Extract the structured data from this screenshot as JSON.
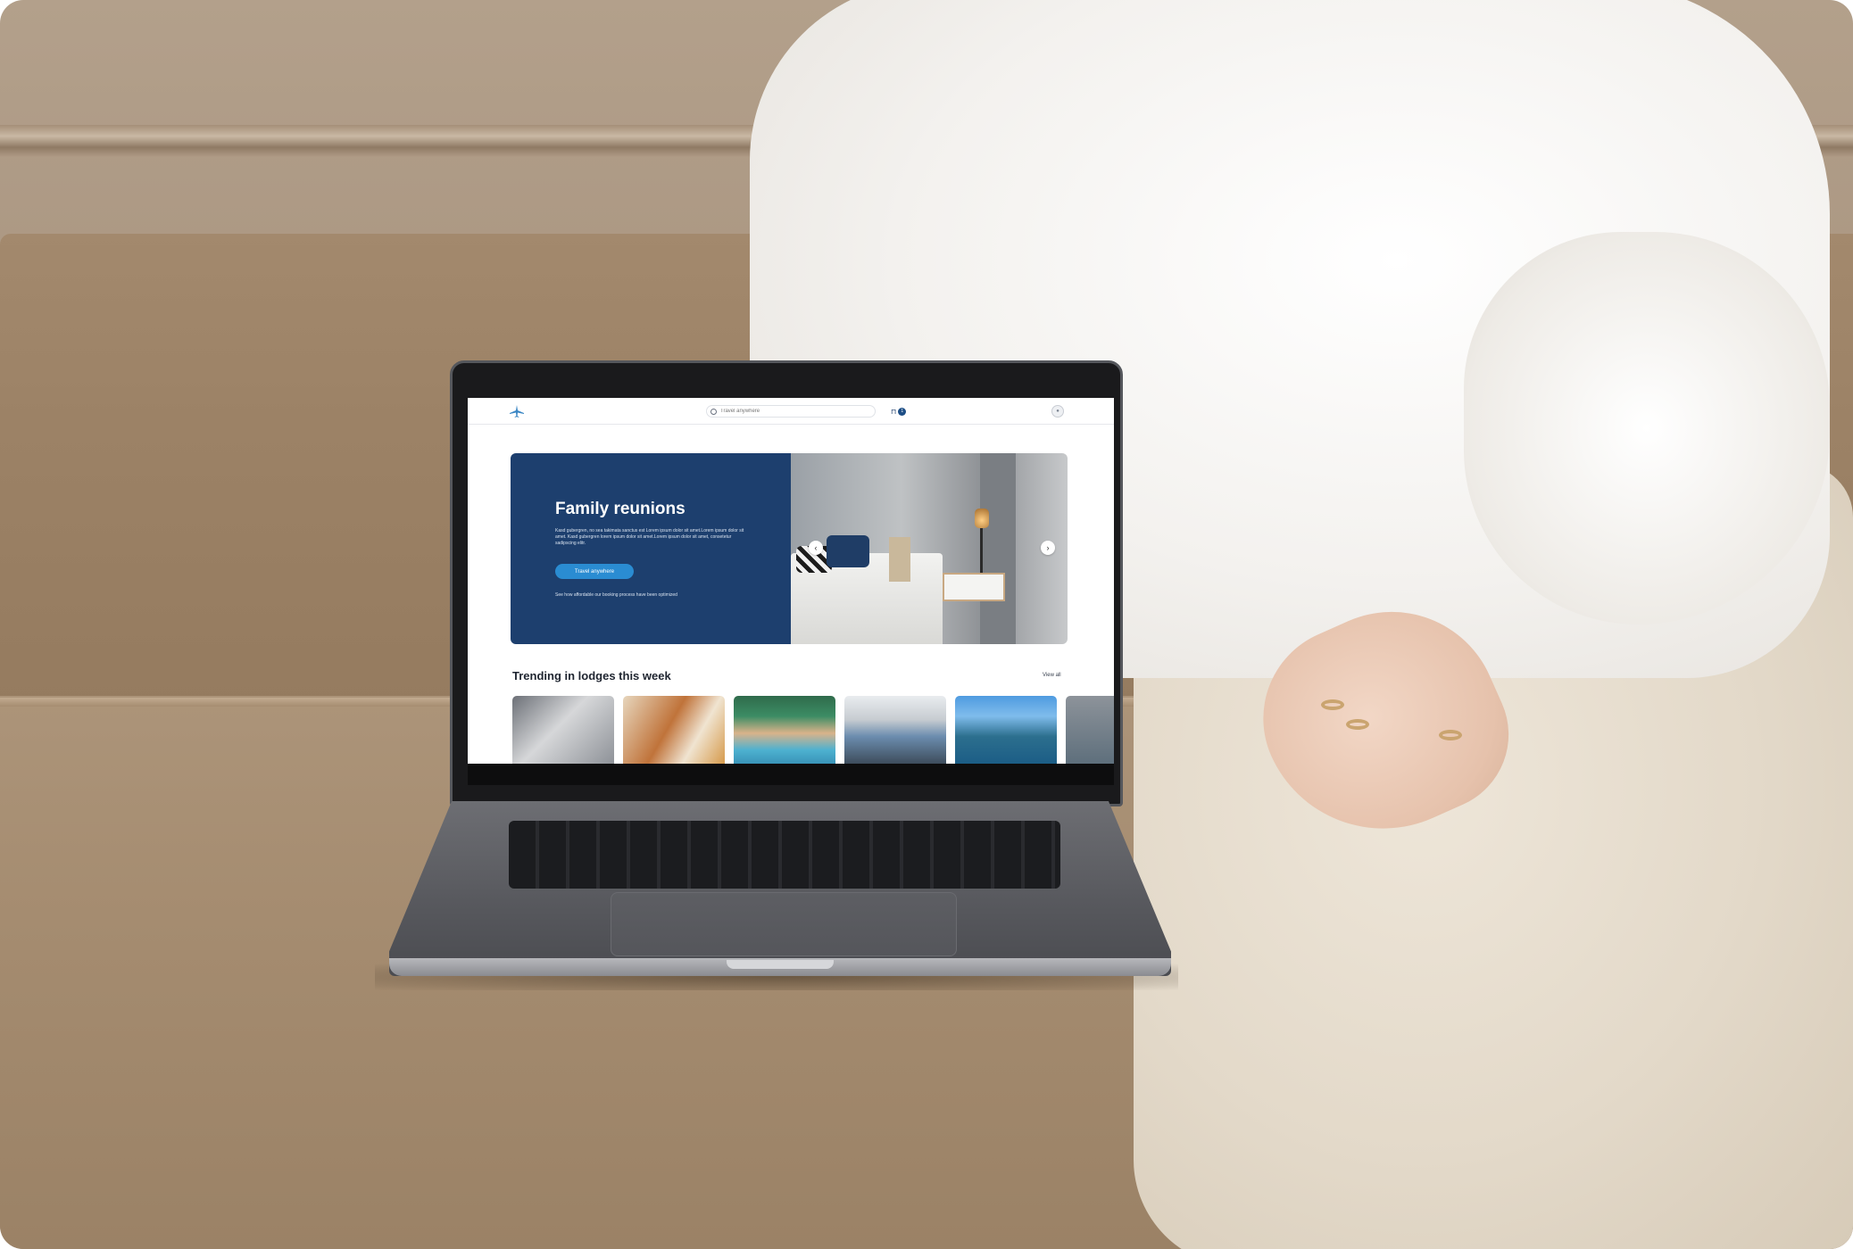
{
  "site": {
    "search": {
      "placeholder": "Travel anywhere",
      "value": "Travel anywhere"
    },
    "cart_count": "1",
    "hero": {
      "title": "Family reunions",
      "body": "Kasd gubergren, no sea takimata sanctus est Lorem ipsum dolor sit amet.Lorem ipsum dolor sit amet. Kasd gubergren lorem ipsum dolor sit amet.Lorem ipsum dolor sit amet, consetetur sadipscing elitr.",
      "button_label": "Travel anywhere",
      "footnote": "See how affordable our booking process have been optimized"
    },
    "trending": {
      "title": "Trending in lodges this week",
      "view_all": "View all"
    },
    "icons": {
      "logo": "airplane-logo-icon",
      "search": "search-icon",
      "cart": "cart-icon",
      "avatar": "user-avatar-icon",
      "prev": "chevron-left-icon",
      "next": "chevron-right-icon"
    },
    "colors": {
      "hero_panel": "#1d3f6e",
      "primary_button": "#2a8cd2",
      "badge": "#1d4e86"
    }
  }
}
